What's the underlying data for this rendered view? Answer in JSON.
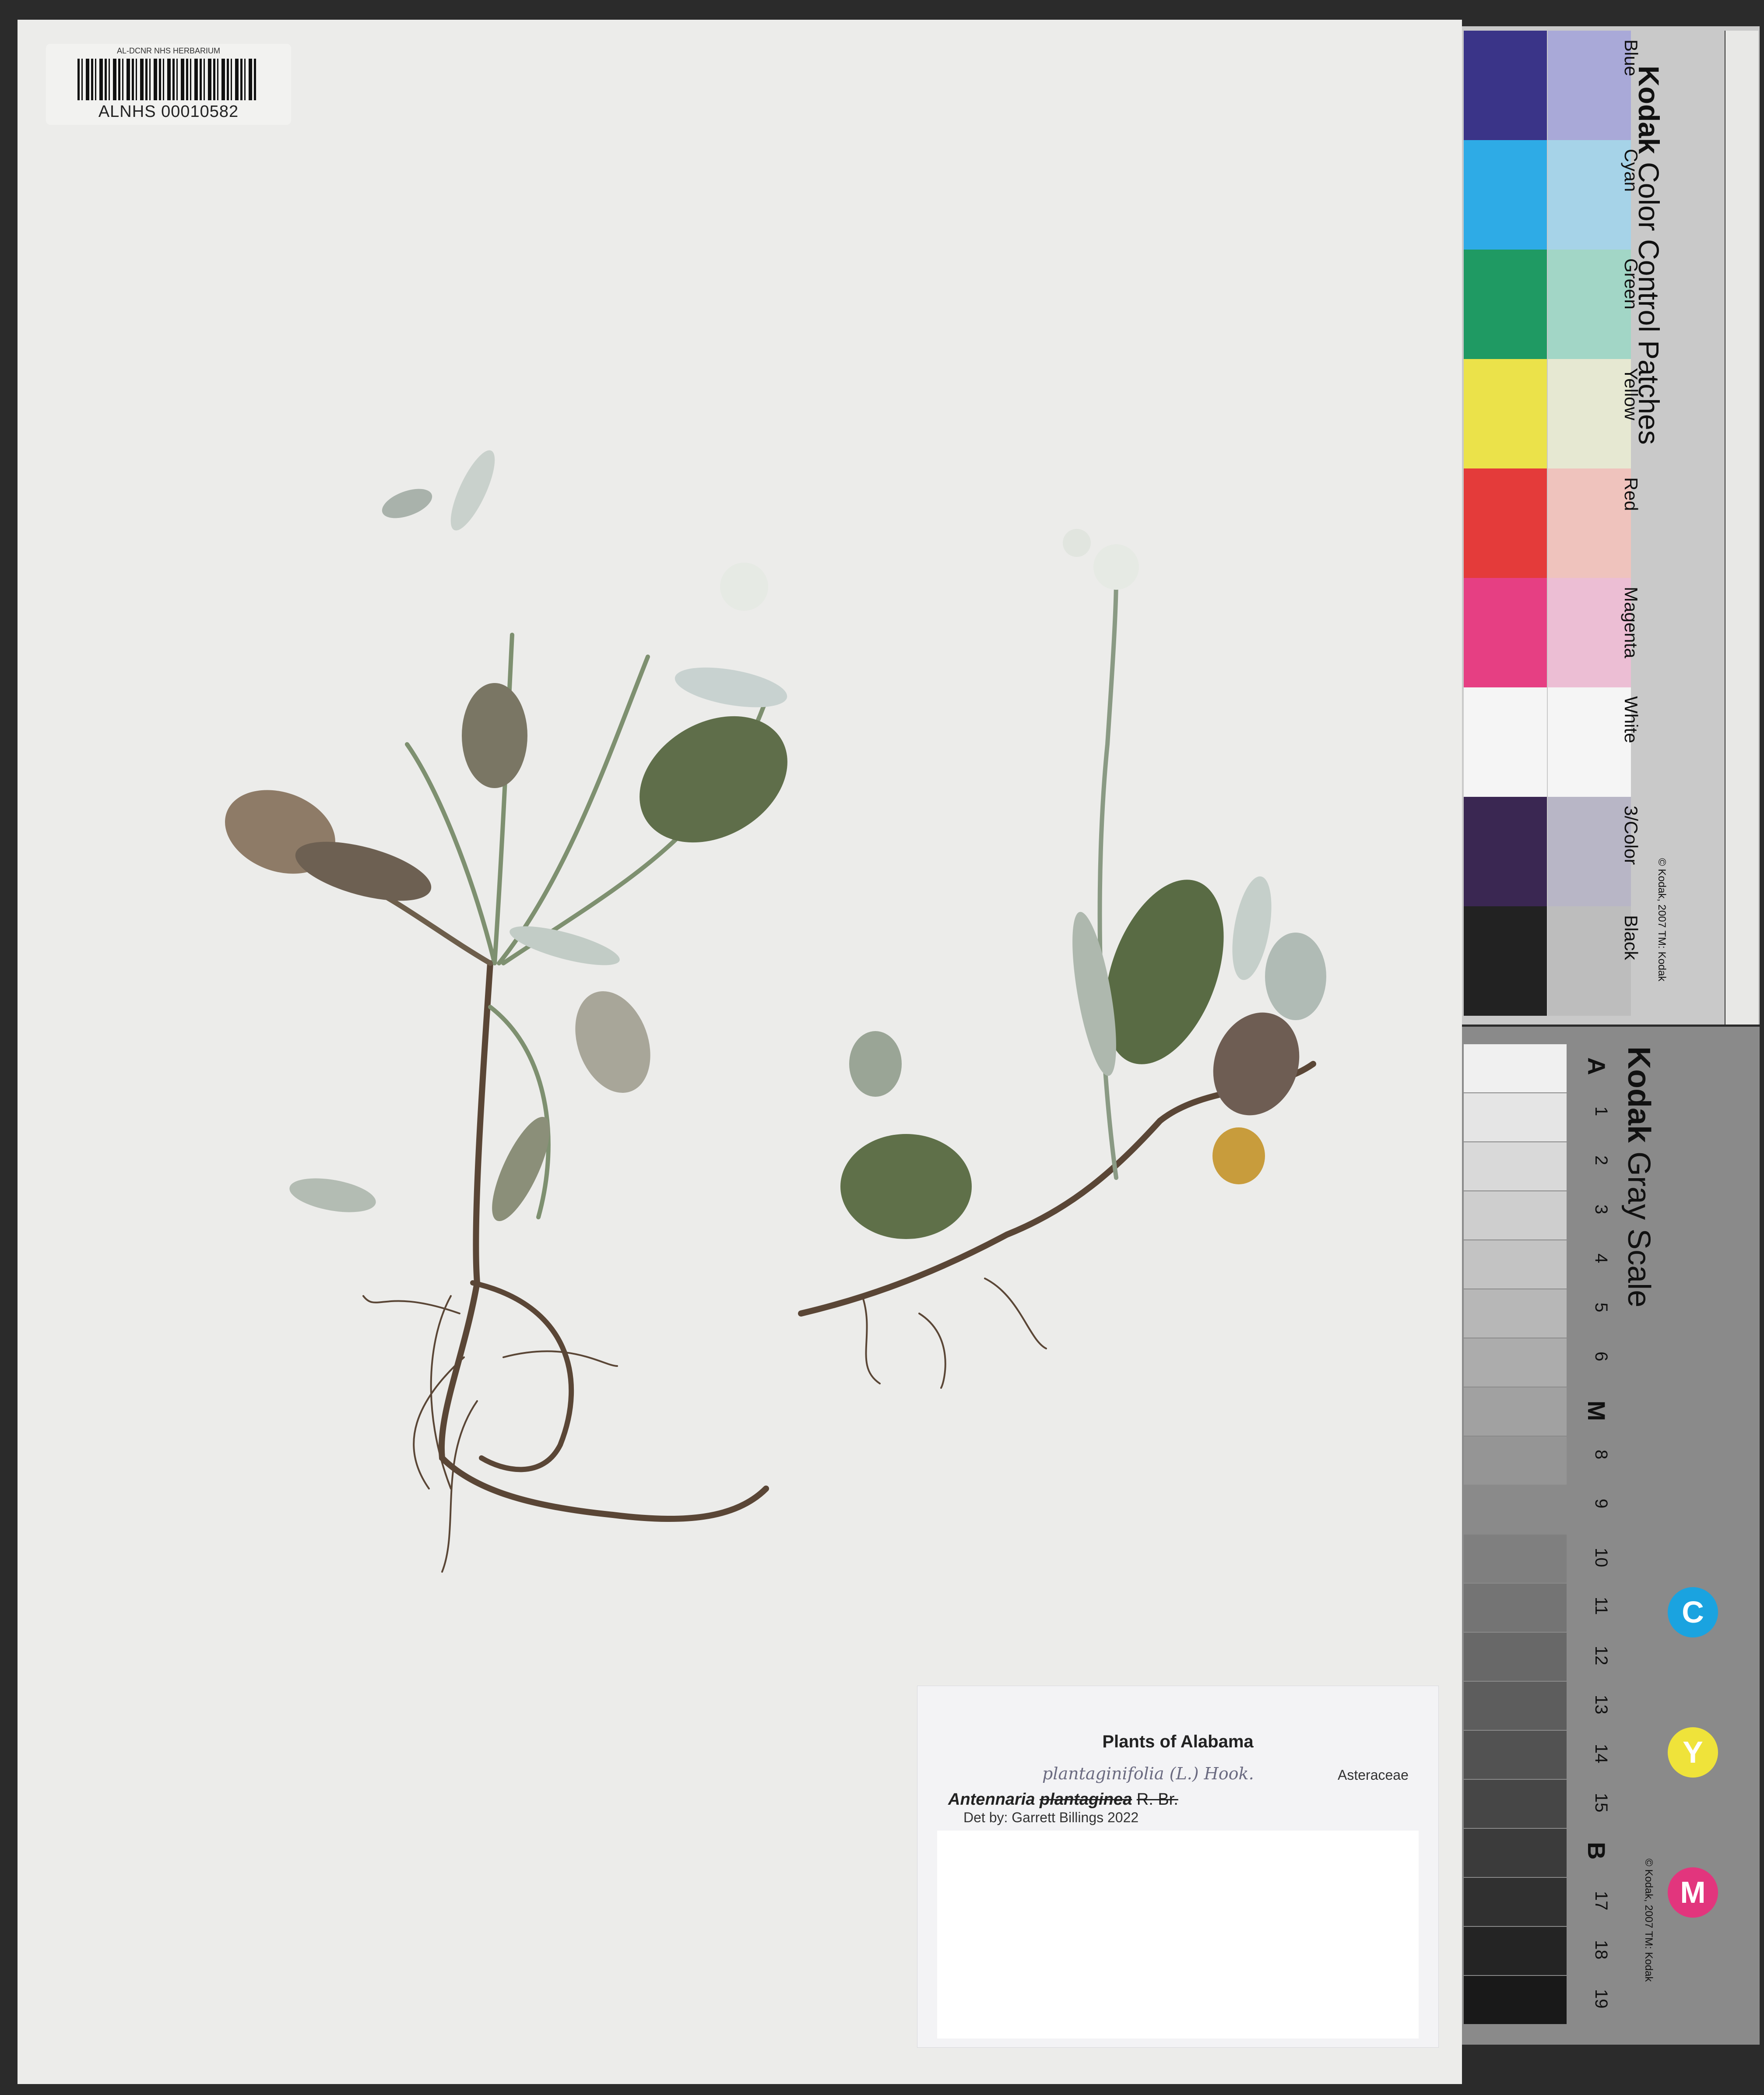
{
  "barcode": {
    "top": "AL-DCNR NHS HERBARIUM",
    "number": "ALNHS 00010582"
  },
  "label": {
    "title": "Plants of Alabama",
    "family": "Asteraceae",
    "annotation": "plantaginifolia (L.) Hook.",
    "genus": "Antennaria",
    "species": "plantaginea",
    "author": "R. Br.",
    "determiner": "Det by: Garrett Billings 2022"
  },
  "color_card": {
    "title_brand": "Kodak",
    "title_rest": " Color Control Patches",
    "patches": [
      {
        "name": "Blue",
        "dark": "#3a3488",
        "light": "#a9a9d8"
      },
      {
        "name": "Cyan",
        "dark": "#2eabe6",
        "light": "#a6d3e8"
      },
      {
        "name": "Green",
        "dark": "#1f9a63",
        "light": "#a2d6c6"
      },
      {
        "name": "Yellow",
        "dark": "#ebe24a",
        "light": "#e6e8d2"
      },
      {
        "name": "Red",
        "dark": "#e43b3a",
        "light": "#efc3bd"
      },
      {
        "name": "Magenta",
        "dark": "#e63f83",
        "light": "#ecbed4"
      },
      {
        "name": "White",
        "dark": "#f5f5f5",
        "light": "#f5f5f5"
      },
      {
        "name": "3/Color",
        "dark": "#3a2752",
        "light": "#b8b6c6"
      },
      {
        "name": "Black",
        "dark": "#222222",
        "light": "#bdbdbd"
      }
    ],
    "copyright": "© Kodak, 2007 TM: Kodak"
  },
  "gray_card": {
    "title_brand": "Kodak",
    "title_rest": " Gray Scale",
    "steps": [
      "A",
      "1",
      "2",
      "3",
      "4",
      "5",
      "6",
      "M",
      "8",
      "9",
      "10",
      "11",
      "12",
      "13",
      "14",
      "15",
      "B",
      "17",
      "18",
      "19"
    ],
    "cym": [
      "C",
      "Y",
      "M"
    ],
    "cym_colors": [
      "#1aa3e0",
      "#efe33a",
      "#e2357d"
    ],
    "copyright": "© Kodak, 2007 TM: Kodak"
  }
}
